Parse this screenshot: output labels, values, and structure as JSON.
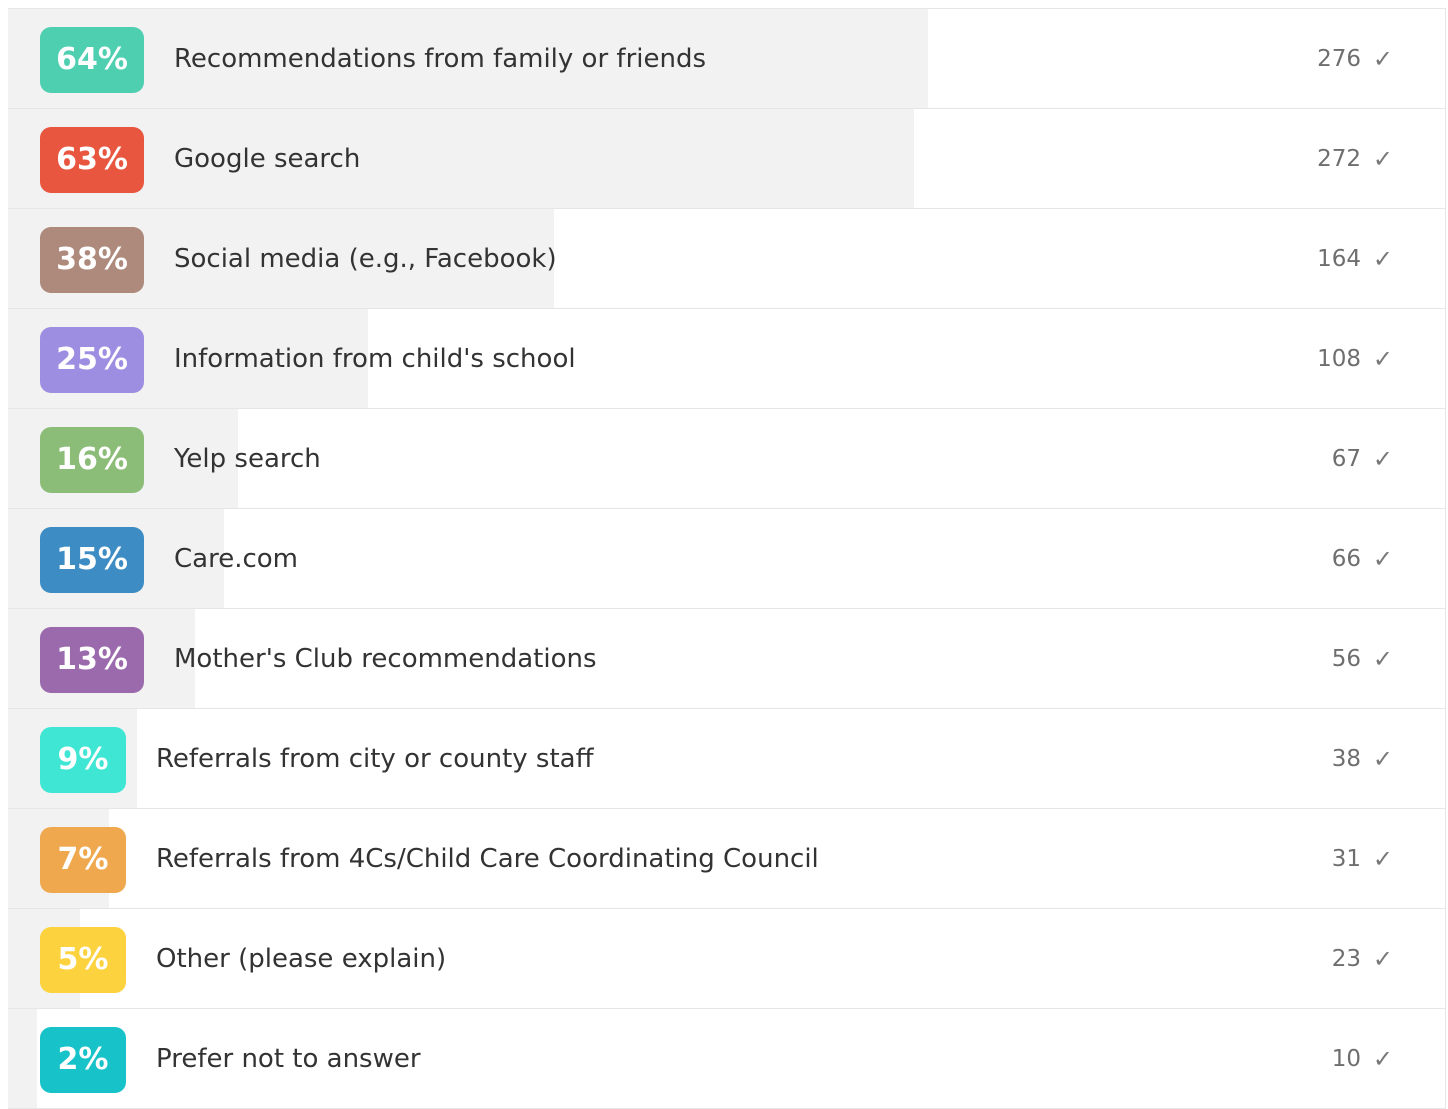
{
  "chart_data": {
    "type": "bar",
    "orientation": "horizontal",
    "categories": [
      "Recommendations from family or friends",
      "Google search",
      "Social media (e.g., Facebook)",
      "Information from child's school",
      "Yelp search",
      "Care.com",
      "Mother's Club recommendations",
      "Referrals from city or county staff",
      "Referrals from 4Cs/Child Care Coordinating Council",
      "Other (please explain)",
      "Prefer not to answer"
    ],
    "percent_labels": [
      "64%",
      "63%",
      "38%",
      "25%",
      "16%",
      "15%",
      "13%",
      "9%",
      "7%",
      "5%",
      "2%"
    ],
    "series": [
      {
        "values": [
          64,
          63,
          38,
          25,
          16,
          15,
          13,
          9,
          7,
          5,
          2
        ]
      }
    ],
    "counts": [
      276,
      272,
      164,
      108,
      67,
      66,
      56,
      38,
      31,
      23,
      10
    ],
    "colors": [
      "#4ecfb0",
      "#e8563f",
      "#ad8a7c",
      "#9d8ee2",
      "#8cbd78",
      "#3d8dc4",
      "#9b6aad",
      "#3fe6d4",
      "#f0a84e",
      "#fdd23f",
      "#17c2c9"
    ],
    "check_icon": "check-icon",
    "xlim": [
      0,
      100
    ]
  }
}
